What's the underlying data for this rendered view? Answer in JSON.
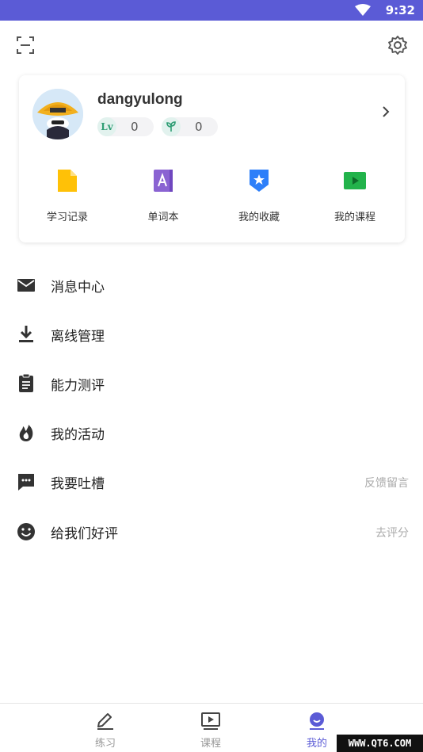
{
  "status_bar": {
    "time": "9:32"
  },
  "profile": {
    "username": "dangyulong",
    "level_badge": "Lv",
    "level_value": "0",
    "sprout_value": "0"
  },
  "shortcuts": [
    {
      "label": "学习记录",
      "icon": "study-record-icon",
      "color": "#ffc107"
    },
    {
      "label": "单词本",
      "icon": "wordbook-icon",
      "color": "#8a63d2"
    },
    {
      "label": "我的收藏",
      "icon": "favorites-icon",
      "color": "#2d7ff9"
    },
    {
      "label": "我的课程",
      "icon": "my-courses-icon",
      "color": "#22b34b"
    }
  ],
  "menu": [
    {
      "label": "消息中心",
      "icon": "mail-icon",
      "right": ""
    },
    {
      "label": "离线管理",
      "icon": "download-icon",
      "right": ""
    },
    {
      "label": "能力测评",
      "icon": "clipboard-icon",
      "right": ""
    },
    {
      "label": "我的活动",
      "icon": "flame-icon",
      "right": ""
    },
    {
      "label": "我要吐槽",
      "icon": "chat-bubble-icon",
      "right": "反馈留言"
    },
    {
      "label": "给我们好评",
      "icon": "smiley-icon",
      "right": "去评分"
    }
  ],
  "tabs": [
    {
      "label": "练习",
      "icon": "pencil-icon",
      "active": false
    },
    {
      "label": "课程",
      "icon": "play-screen-icon",
      "active": false
    },
    {
      "label": "我的",
      "icon": "profile-face-icon",
      "active": true
    }
  ],
  "watermark": "WWW.QT6.COM",
  "colors": {
    "accent": "#5b5bd6",
    "text": "#222222",
    "muted": "#aaaaaa"
  }
}
